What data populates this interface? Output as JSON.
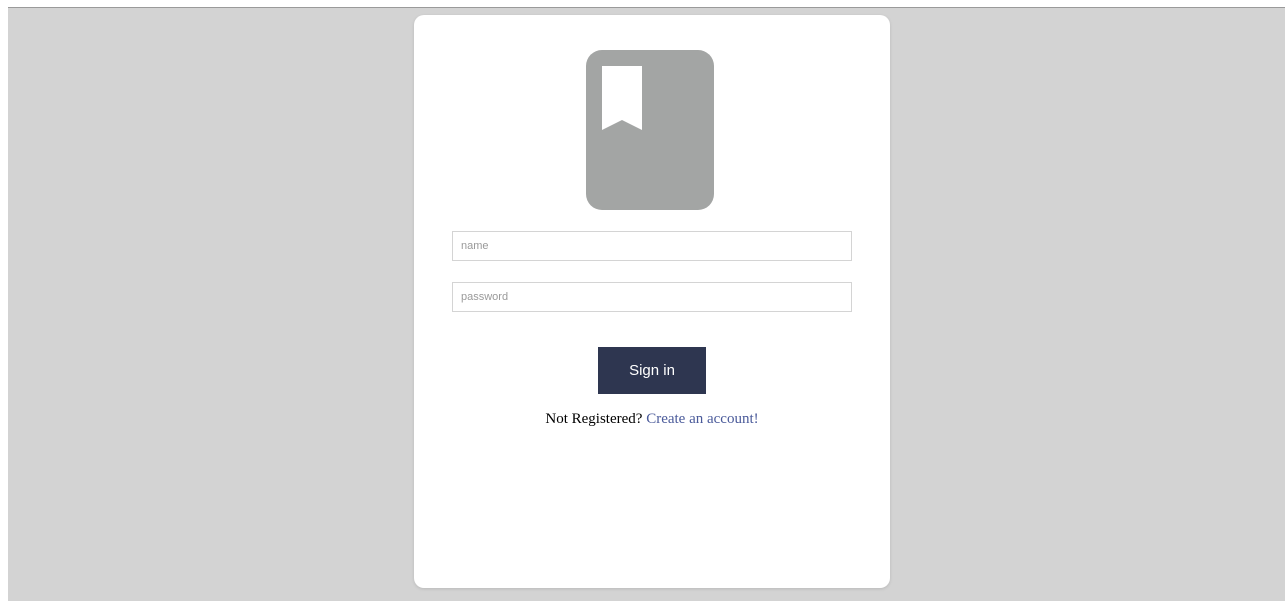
{
  "login": {
    "name_placeholder": "name",
    "password_placeholder": "password",
    "signin_label": "Sign in",
    "register_prompt": "Not Registered?",
    "register_link": "Create an account!"
  },
  "colors": {
    "page_background": "#d3d3d3",
    "card_background": "#ffffff",
    "logo_background": "#a3a5a4",
    "button_background": "#2e3650",
    "link_color": "#4a5a9a"
  },
  "icons": {
    "logo": "bookmark-book-icon"
  }
}
